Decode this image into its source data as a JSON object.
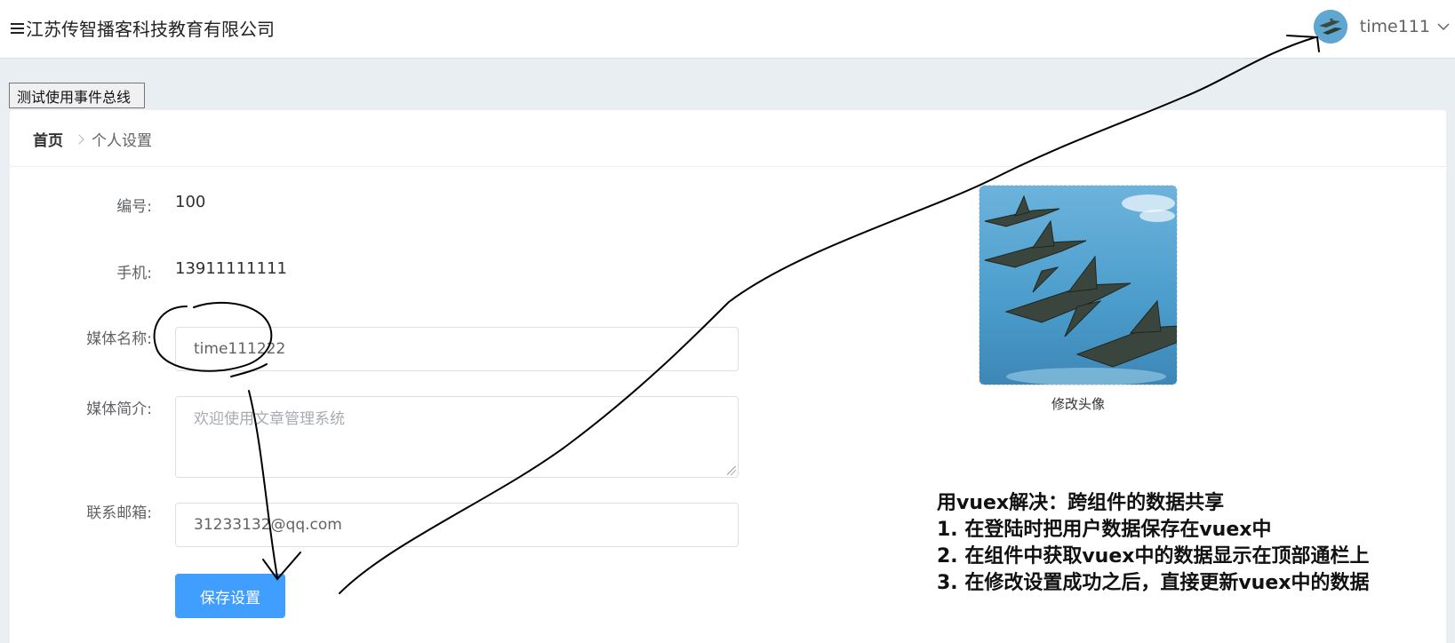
{
  "header": {
    "company": "江苏传智播客科技教育有限公司",
    "username": "time111"
  },
  "test_button": "测试使用事件总线",
  "breadcrumb": {
    "home": "首页",
    "current": "个人设置"
  },
  "form": {
    "id_label": "编号:",
    "id_value": "100",
    "phone_label": "手机:",
    "phone_value": "13911111111",
    "media_name_label": "媒体名称:",
    "media_name_value": "time111222",
    "intro_label": "媒体简介:",
    "intro_placeholder": "欢迎使用文章管理系统",
    "email_label": "联系邮箱:",
    "email_value": "31233132@qq.com",
    "save_label": "保存设置"
  },
  "avatar": {
    "caption": "修改头像"
  },
  "notes": {
    "line1": "用vuex解决：跨组件的数据共享",
    "line2": "1. 在登陆时把用户数据保存在vuex中",
    "line3": "2. 在组件中获取vuex中的数据显示在顶部通栏上",
    "line4": "3. 在修改设置成功之后，直接更新vuex中的数据"
  },
  "icons": {
    "menu": "hamburger-icon",
    "caret": "chevron-down-icon",
    "breadcrumb_separator": "chevron-right-icon"
  },
  "colors": {
    "primary": "#409eff",
    "page_bg": "#e9eef3"
  }
}
